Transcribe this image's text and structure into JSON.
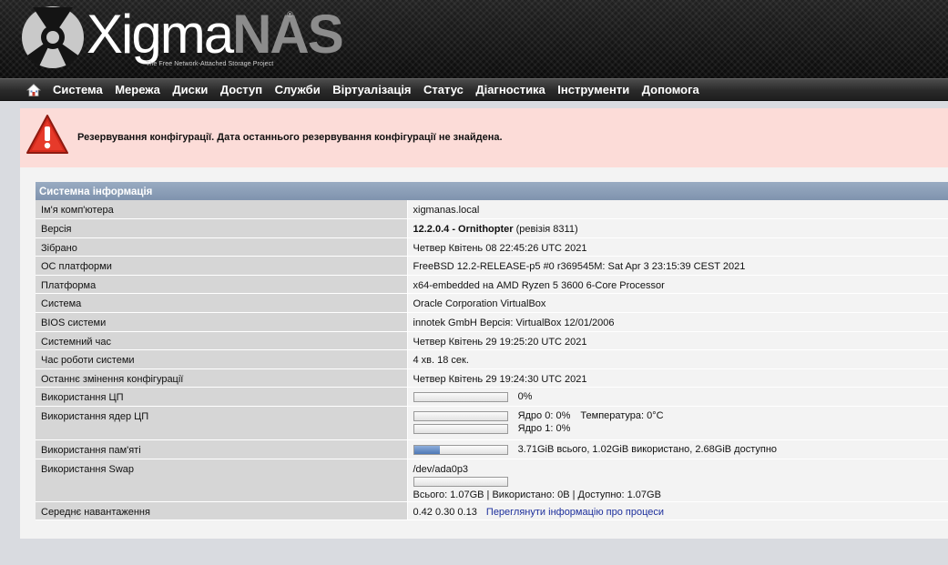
{
  "header": {
    "logo_main": "Xigma",
    "logo_accent": "NAS",
    "logo_reg": "®",
    "tagline": "The Free Network-Attached Storage Project"
  },
  "nav": {
    "home_icon": "home-icon",
    "items": [
      "Система",
      "Мережа",
      "Диски",
      "Доступ",
      "Служби",
      "Віртуалізація",
      "Статус",
      "Діагностика",
      "Інструменти",
      "Допомога"
    ]
  },
  "alert": {
    "icon": "warning-triangle-icon",
    "message": "Резервування конфігурації. Дата останнього резервування конфігурації не знайдена."
  },
  "sysinfo": {
    "title": "Системна інформація",
    "hostname": {
      "label": "Ім'я комп'ютера",
      "value": "xigmanas.local"
    },
    "version": {
      "label": "Версія",
      "number": "12.2.0.4",
      "separator": " - ",
      "name": "Ornithopter",
      "revision": " (ревізія 8311)"
    },
    "built": {
      "label": "Зібрано",
      "value": "Четвер Квітень 08 22:45:26 UTC 2021"
    },
    "os": {
      "label": "ОС платформи",
      "value": "FreeBSD 12.2-RELEASE-p5 #0 r369545M: Sat Apr 3 23:15:39 CEST 2021"
    },
    "platform": {
      "label": "Платформа",
      "value": "x64-embedded на AMD Ryzen 5 3600 6-Core Processor"
    },
    "system": {
      "label": "Система",
      "value": "Oracle Corporation VirtualBox"
    },
    "bios": {
      "label": "BIOS системи",
      "value": "innotek GmbH Версія: VirtualBox 12/01/2006"
    },
    "clock": {
      "label": "Системний час",
      "value": "Четвер Квітень 29 19:25:20 UTC 2021"
    },
    "uptime": {
      "label": "Час роботи системи",
      "value": "4 хв. 18 сек."
    },
    "lastconfig": {
      "label": "Останнє змінення конфігурації",
      "value": "Четвер Квітень 29 19:24:30 UTC 2021"
    },
    "cpu": {
      "label": "Використання ЦП",
      "text": "0%",
      "usage": 0
    },
    "cores": {
      "label": "Використання ядер ЦП",
      "core0": "Ядро 0: 0%",
      "temp": "Температура: 0°C",
      "core1": "Ядро 1: 0%",
      "usage0": 0,
      "usage1": 0
    },
    "memory": {
      "label": "Використання пам'яті",
      "text": "3.71GiB всього, 1.02GiB використано, 2.68GiB доступно",
      "usage": 0.28
    },
    "swap": {
      "label": "Використання Swap",
      "device": "/dev/ada0p3",
      "summary": "Всього: 1.07GB | Використано: 0B | Доступно: 1.07GB",
      "usage": 0
    },
    "load": {
      "label": "Середнє навантаження",
      "value": "0.42 0.30 0.13",
      "link": "Переглянути інформацію про процеси"
    }
  }
}
